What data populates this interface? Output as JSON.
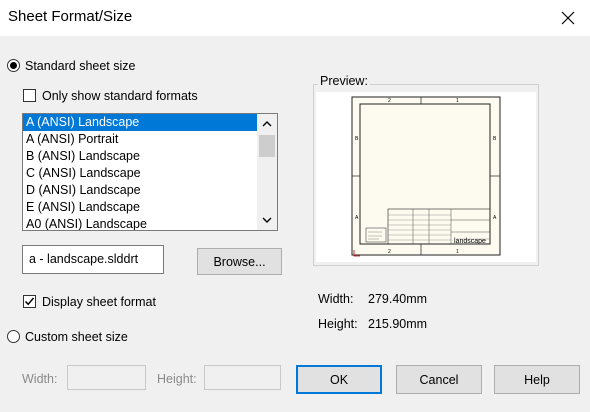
{
  "window": {
    "title": "Sheet Format/Size"
  },
  "standard": {
    "label": "Standard sheet size",
    "only_standard_label": "Only show standard formats",
    "formats": [
      "A (ANSI) Landscape",
      "A (ANSI) Portrait",
      "B (ANSI) Landscape",
      "C (ANSI) Landscape",
      "D (ANSI) Landscape",
      "E (ANSI) Landscape",
      "A0 (ANSI) Landscape"
    ],
    "selected_index": 0,
    "format_file": "a - landscape.slddrt",
    "browse_label": "Browse...",
    "display_format_label": "Display sheet format"
  },
  "custom": {
    "label": "Custom sheet size",
    "width_label": "Width:",
    "height_label": "Height:",
    "width_value": "",
    "height_value": ""
  },
  "preview": {
    "label": "Preview:",
    "zone_top": [
      "2",
      "1"
    ],
    "zone_side": [
      "B",
      "A"
    ],
    "title_name": "landscape",
    "width_label": "Width:",
    "width_value": "279.40mm",
    "height_label": "Height:",
    "height_value": "215.90mm"
  },
  "buttons": {
    "ok": "OK",
    "cancel": "Cancel",
    "help": "Help"
  },
  "colors": {
    "selection": "#0078d7",
    "sheet": "#fdfbef"
  }
}
